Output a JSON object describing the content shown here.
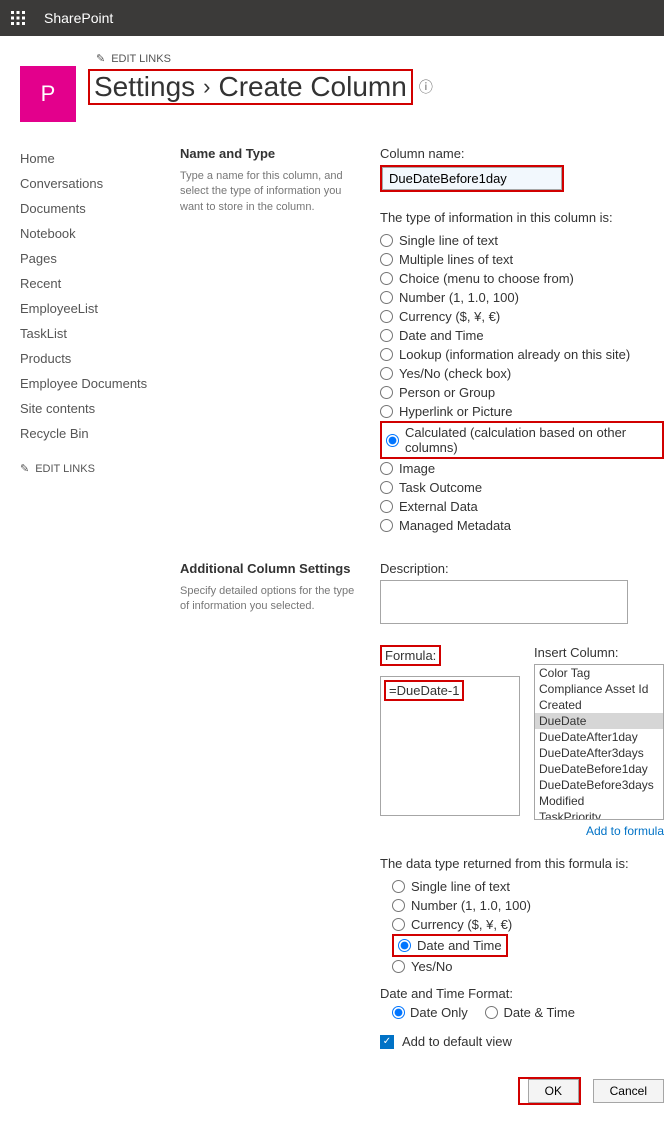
{
  "topbar": {
    "brand": "SharePoint"
  },
  "siteTile": "P",
  "editLinks": "EDIT LINKS",
  "breadcrumb": {
    "settings": "Settings",
    "create": "Create Column"
  },
  "sidebar": {
    "items": [
      "Home",
      "Conversations",
      "Documents",
      "Notebook",
      "Pages",
      "Recent",
      "EmployeeList",
      "TaskList",
      "Products",
      "Employee Documents",
      "Site contents",
      "Recycle Bin"
    ],
    "edit": "EDIT LINKS"
  },
  "section1": {
    "title": "Name and Type",
    "desc": "Type a name for this column, and select the type of information you want to store in the column."
  },
  "colname": {
    "label": "Column name:",
    "value": "DueDateBefore1day"
  },
  "typeHeader": "The type of information in this column is:",
  "types": [
    "Single line of text",
    "Multiple lines of text",
    "Choice (menu to choose from)",
    "Number (1, 1.0, 100)",
    "Currency ($, ¥, €)",
    "Date and Time",
    "Lookup (information already on this site)",
    "Yes/No (check box)",
    "Person or Group",
    "Hyperlink or Picture",
    "Calculated (calculation based on other columns)",
    "Image",
    "Task Outcome",
    "External Data",
    "Managed Metadata"
  ],
  "section2": {
    "title": "Additional Column Settings",
    "desc": "Specify detailed options for the type of information you selected."
  },
  "descLabel": "Description:",
  "formulaLabel": "Formula:",
  "formulaValue": "=DueDate-1",
  "insertLabel": "Insert Column:",
  "insertItems": [
    "Color Tag",
    "Compliance Asset Id",
    "Created",
    "DueDate",
    "DueDateAfter1day",
    "DueDateAfter3days",
    "DueDateBefore1day",
    "DueDateBefore3days",
    "Modified",
    "TaskPriority"
  ],
  "addFormula": "Add to formula",
  "returnHeader": "The data type returned from this formula is:",
  "returnTypes": [
    "Single line of text",
    "Number (1, 1.0, 100)",
    "Currency ($, ¥, €)",
    "Date and Time",
    "Yes/No"
  ],
  "dtFormatLabel": "Date and Time Format:",
  "dtFormat": {
    "dateOnly": "Date Only",
    "dateTime": "Date & Time"
  },
  "defaultView": "Add to default view",
  "buttons": {
    "ok": "OK",
    "cancel": "Cancel"
  }
}
